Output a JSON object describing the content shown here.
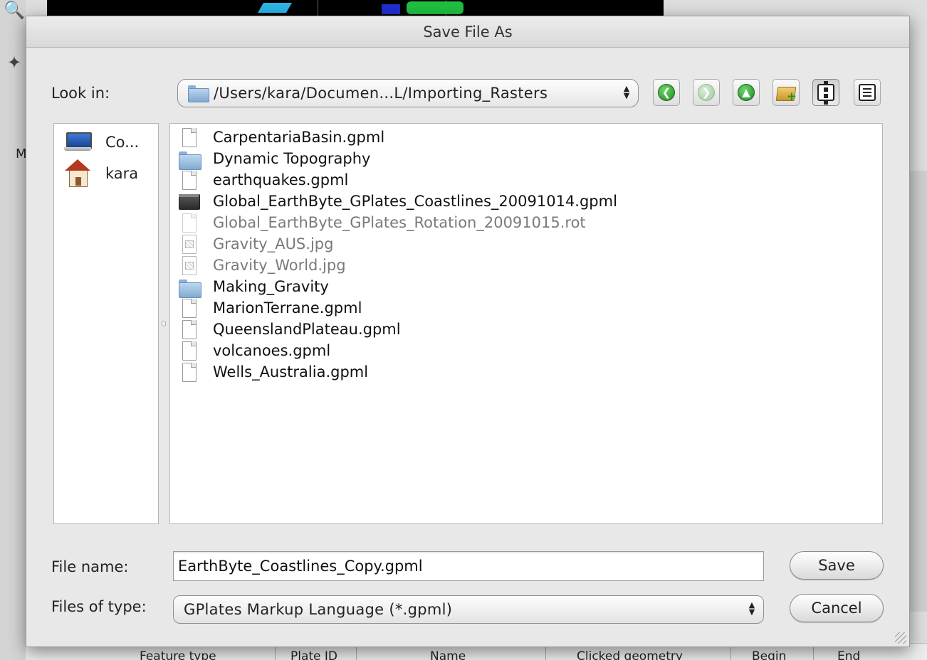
{
  "background": {
    "label_m": "M",
    "table_columns": [
      "Feature type",
      "Plate ID",
      "Name",
      "Clicked geometry",
      "Begin",
      "End"
    ]
  },
  "dialog": {
    "title": "Save File As",
    "look_in": {
      "label": "Look in:",
      "path": "/Users/kara/Documen...L/Importing_Rasters"
    },
    "toolbar": {
      "back_icon": "back-arrow-icon",
      "forward_icon": "forward-arrow-icon",
      "up_icon": "up-arrow-icon",
      "new_folder_icon": "new-folder-icon",
      "list_view_icon": "list-view-icon",
      "details_view_icon": "details-view-icon"
    },
    "places": [
      {
        "label": "Co...",
        "icon": "computer-icon"
      },
      {
        "label": "kara",
        "icon": "home-icon"
      }
    ],
    "files": [
      {
        "name": "CarpentariaBasin.gpml",
        "kind": "doc"
      },
      {
        "name": "Dynamic Topography",
        "kind": "folder"
      },
      {
        "name": "earthquakes.gpml",
        "kind": "doc"
      },
      {
        "name": "Global_EarthByte_GPlates_Coastlines_20091014.gpml",
        "kind": "dark"
      },
      {
        "name": "Global_EarthByte_GPlates_Rotation_20091015.rot",
        "kind": "doc-faded"
      },
      {
        "name": "Gravity_AUS.jpg",
        "kind": "img"
      },
      {
        "name": "Gravity_World.jpg",
        "kind": "img"
      },
      {
        "name": "Making_Gravity",
        "kind": "folder"
      },
      {
        "name": "MarionTerrane.gpml",
        "kind": "doc"
      },
      {
        "name": "QueenslandPlateau.gpml",
        "kind": "doc"
      },
      {
        "name": "volcanoes.gpml",
        "kind": "doc"
      },
      {
        "name": "Wells_Australia.gpml",
        "kind": "doc"
      }
    ],
    "file_name": {
      "label": "File name:",
      "value": "EarthByte_Coastlines_Copy.gpml"
    },
    "file_type": {
      "label": "Files of type:",
      "value": "GPlates Markup Language (*.gpml)"
    },
    "save_label": "Save",
    "cancel_label": "Cancel"
  },
  "colors": {
    "accent_green": "#1d8a1d",
    "folder_blue": "#82aad2"
  }
}
